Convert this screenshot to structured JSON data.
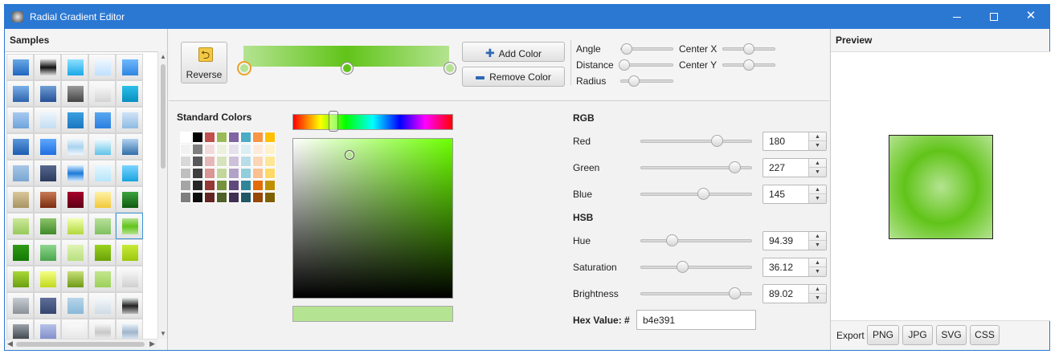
{
  "window": {
    "title": "Radial Gradient Editor",
    "controls": [
      "minimize",
      "maximize",
      "close"
    ]
  },
  "samples": {
    "title": "Samples",
    "swatches": [
      "linear-gradient(#6aa9e6,#1f66bf)",
      "linear-gradient(#d8d8d8,#111,#ddd)",
      "linear-gradient(#8fe0ff,#1aa7e8)",
      "linear-gradient(#eef7ff,#bfe0ff)",
      "linear-gradient(#6fb7ff,#2e86e0)",
      "linear-gradient(#7ab0e8,#2d63ad)",
      "linear-gradient(#6f9fd6,#254f95)",
      "linear-gradient(#9a9a9a,#444)",
      "linear-gradient(#f7f7f7,#d4d4d4)",
      "linear-gradient(#2bc0e8,#078fbf)",
      "linear-gradient(#a6c9ef,#6fa4dc)",
      "linear-gradient(#eef5fb,#c3def3)",
      "linear-gradient(#3aa0e0,#1c76c0)",
      "linear-gradient(#5aa8f0,#2c7fe0)",
      "linear-gradient(#cfe3f6,#8fbbe3)",
      "linear-gradient(#5d98dc,#1b5cb0)",
      "linear-gradient(#5ea8ff,#1f6ee0)",
      "linear-gradient(#eef6fc,#a9d3ef,#eef6fc)",
      "linear-gradient(#f5fbff,#5ec3e8)",
      "linear-gradient(#b3d3f0,#2f6eaa)",
      "linear-gradient(#a7c6e6,#7aa6d2)",
      "linear-gradient(#55678e,#2c3a5e)",
      "linear-gradient(#d8ecff,#1a7ad8,#d8ecff)",
      "linear-gradient(#e6f7ff,#b6e6fb)",
      "linear-gradient(#7ad4ff,#18a4e0)",
      "linear-gradient(#d9c79b,#a89464)",
      "linear-gradient(#c97a55,#7b2c10)",
      "linear-gradient(#a8002c,#5c0016)",
      "linear-gradient(#fff2a8,#f2c838)",
      "linear-gradient(#3da33d,#0e5a0e)",
      "linear-gradient(#cde99a,#96c95a)",
      "linear-gradient(#8cc46a,#3f8a28)",
      "linear-gradient(#f2ffb3,#b2d83a)",
      "linear-gradient(#b8e09a,#80c060)",
      "linear-gradient(#b4e391,#61c419,#b4e391)",
      "linear-gradient(#2f9a16,#147a06)",
      "linear-gradient(#8fd68f,#4aa54a)",
      "linear-gradient(#dff4b1,#b8e080)",
      "linear-gradient(#9ad21e,#6aa20a)",
      "linear-gradient(#c8ea38,#9cc80e)",
      "linear-gradient(#a8d83a,#6aa010)",
      "linear-gradient(#f4ff86,#c2d81c)",
      "linear-gradient(#c8e07a,#6e9a16)",
      "linear-gradient(#c2e68e,#9cd05a)",
      "linear-gradient(#f4f4f4,#d0d0d0)",
      "linear-gradient(#c8ccd2,#8a9098)",
      "linear-gradient(#5e6e9a,#34466e)",
      "linear-gradient(#b8d6ea,#88b8d8)",
      "linear-gradient(#f4f8fb,#cfdbe5)",
      "linear-gradient(#e8eeee,#222,#bbb)",
      "linear-gradient(#9aa2aa,#3a3f46)",
      "linear-gradient(#b6c2e8,#7a8ac8)",
      "linear-gradient(#fafafa,#e4e4e4)",
      "linear-gradient(#f2f2f2,#c8c8c8,#f2f2f2)",
      "linear-gradient(#e6eef6,#9fb6cc,#e6eef6)"
    ]
  },
  "toolbar": {
    "reverse_label": "Reverse",
    "add_color_label": "Add Color",
    "remove_color_label": "Remove Color",
    "angle_label": "Angle",
    "distance_label": "Distance",
    "radius_label": "Radius",
    "center_x_label": "Center X",
    "center_y_label": "Center Y",
    "gradient_colors": [
      "#b4e391",
      "#61c419",
      "#b4e391"
    ]
  },
  "standard_colors": {
    "title": "Standard Colors",
    "colors": [
      "#ffffff",
      "#000000",
      "#c0504d",
      "#9bbb59",
      "#8064a2",
      "#4bacc6",
      "#f79646",
      "#ffc000",
      "#f2f2f2",
      "#7f7f7f",
      "#f2dcdb",
      "#ebf1dd",
      "#e5e0ec",
      "#dbeef3",
      "#fdeada",
      "#fff2ca",
      "#d8d8d8",
      "#595959",
      "#e6b8b7",
      "#d7e3bc",
      "#ccc1d9",
      "#b7dde8",
      "#fbd5b5",
      "#ffe694",
      "#bfbfbf",
      "#3f3f3f",
      "#d99694",
      "#c3d69b",
      "#b2a2c7",
      "#92cddc",
      "#fac08f",
      "#ffd966",
      "#a5a5a5",
      "#262626",
      "#953734",
      "#76923c",
      "#5f497a",
      "#31859b",
      "#e36c09",
      "#bf9000",
      "#7f7f7f",
      "#0c0c0c",
      "#632423",
      "#4f6128",
      "#3f3151",
      "#205867",
      "#974806",
      "#7f6000"
    ]
  },
  "picker": {
    "current_color": "#b4e391"
  },
  "rgb": {
    "title": "RGB",
    "red_label": "Red",
    "red": "180",
    "red_level": 0.706,
    "green_label": "Green",
    "green": "227",
    "green_level": 0.89,
    "blue_label": "Blue",
    "blue": "145",
    "blue_level": 0.569
  },
  "hsb": {
    "title": "HSB",
    "hue_label": "Hue",
    "hue": "94.39",
    "hue_level": 0.262,
    "saturation_label": "Saturation",
    "saturation": "36.12",
    "saturation_level": 0.361,
    "brightness_label": "Brightness",
    "brightness": "89.02",
    "brightness_level": 0.89
  },
  "hex": {
    "label": "Hex Value: #",
    "value": "b4e391"
  },
  "preview": {
    "title": "Preview",
    "export_label": "Export",
    "export_png": "PNG",
    "export_jpg": "JPG",
    "export_svg": "SVG",
    "export_css": "CSS"
  }
}
